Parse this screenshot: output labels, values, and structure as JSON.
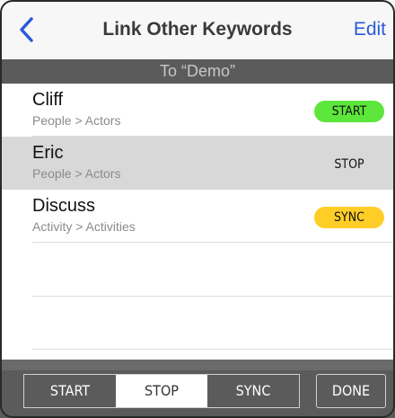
{
  "nav": {
    "back_icon": "chevron-left-icon",
    "title": "Link Other Keywords",
    "edit_label": "Edit",
    "accent": "#2b5bd7"
  },
  "section": {
    "label": "To “Demo”"
  },
  "rows": [
    {
      "name": "Cliff",
      "path": "People > Actors",
      "action": "START",
      "selected": false,
      "action_color": "#5de63c"
    },
    {
      "name": "Eric",
      "path": "People > Actors",
      "action": "STOP",
      "selected": true,
      "action_color": "transparent"
    },
    {
      "name": "Discuss",
      "path": "Activity > Activities",
      "action": "SYNC",
      "selected": false,
      "action_color": "#ffce26"
    }
  ],
  "toolbar": {
    "segments": [
      {
        "label": "START",
        "active": false
      },
      {
        "label": "STOP",
        "active": true
      },
      {
        "label": "SYNC",
        "active": false
      }
    ],
    "done_label": "DONE"
  }
}
